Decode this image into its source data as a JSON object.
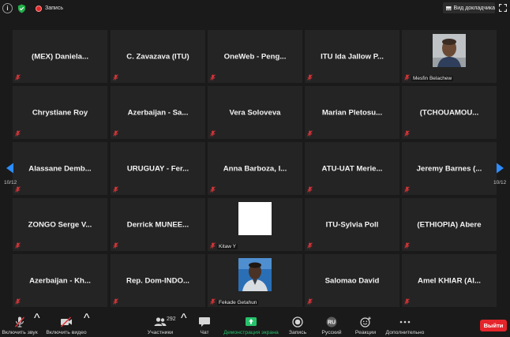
{
  "topbar": {
    "recording_label": "Запись",
    "view_label": "Вид докладчика"
  },
  "tiles": [
    {
      "name": "(MEX)  Daniela...",
      "type": "name"
    },
    {
      "name": "C. Zavazava (ITU)",
      "type": "name"
    },
    {
      "name": "OneWeb - Peng...",
      "type": "name"
    },
    {
      "name": "ITU Ida Jallow P...",
      "type": "name"
    },
    {
      "name": "Mesfin Belachew",
      "type": "photo"
    },
    {
      "name": "Chrystiane Roy",
      "type": "name"
    },
    {
      "name": "Azerbaijan - Sa...",
      "type": "name"
    },
    {
      "name": "Vera Soloveva",
      "type": "name"
    },
    {
      "name": "Marian Pletosu...",
      "type": "name"
    },
    {
      "name": "(TCHOUAMOU...",
      "type": "name"
    },
    {
      "name": "Alassane  Demb...",
      "type": "name"
    },
    {
      "name": "URUGUAY - Fer...",
      "type": "name"
    },
    {
      "name": "Anna Barboza, I...",
      "type": "name"
    },
    {
      "name": "ATU-UAT Merie...",
      "type": "name"
    },
    {
      "name": "Jeremy Barnes (...",
      "type": "name"
    },
    {
      "name": "ZONGO Serge V...",
      "type": "name"
    },
    {
      "name": "Derrick  MUNEE...",
      "type": "name"
    },
    {
      "name": "Kitaw Y",
      "type": "blank"
    },
    {
      "name": "ITU-Sylvia Poll",
      "type": "name"
    },
    {
      "name": "(ETHIOPIA) Abere",
      "type": "name"
    },
    {
      "name": "Azerbaijan - Kh...",
      "type": "name"
    },
    {
      "name": "Rep. Dom-INDO...",
      "type": "name"
    },
    {
      "name": "Fekade Getahun",
      "type": "photo"
    },
    {
      "name": "Salomao David",
      "type": "name"
    },
    {
      "name": "Amel KHIAR (Al...",
      "type": "name"
    }
  ],
  "pagination": {
    "left": "10/12",
    "right": "10/12"
  },
  "toolbar": {
    "mic_label": "Включить звук",
    "video_label": "Включить видео",
    "participants_label": "Участники",
    "participants_count": "292",
    "chat_label": "Чат",
    "share_label": "Демонстрация экрана",
    "record_label": "Запись",
    "language_label": "Русский",
    "language_code": "RU",
    "reactions_label": "Реакции",
    "more_label": "Дополнительно",
    "exit_label": "Выйти"
  },
  "colors": {
    "tile_bg": "#242424",
    "background": "#1a1a1a",
    "accent_blue": "#2d8cff",
    "share_green": "#26c26b",
    "exit_red": "#e5252b",
    "muted_red": "#d9353a"
  }
}
